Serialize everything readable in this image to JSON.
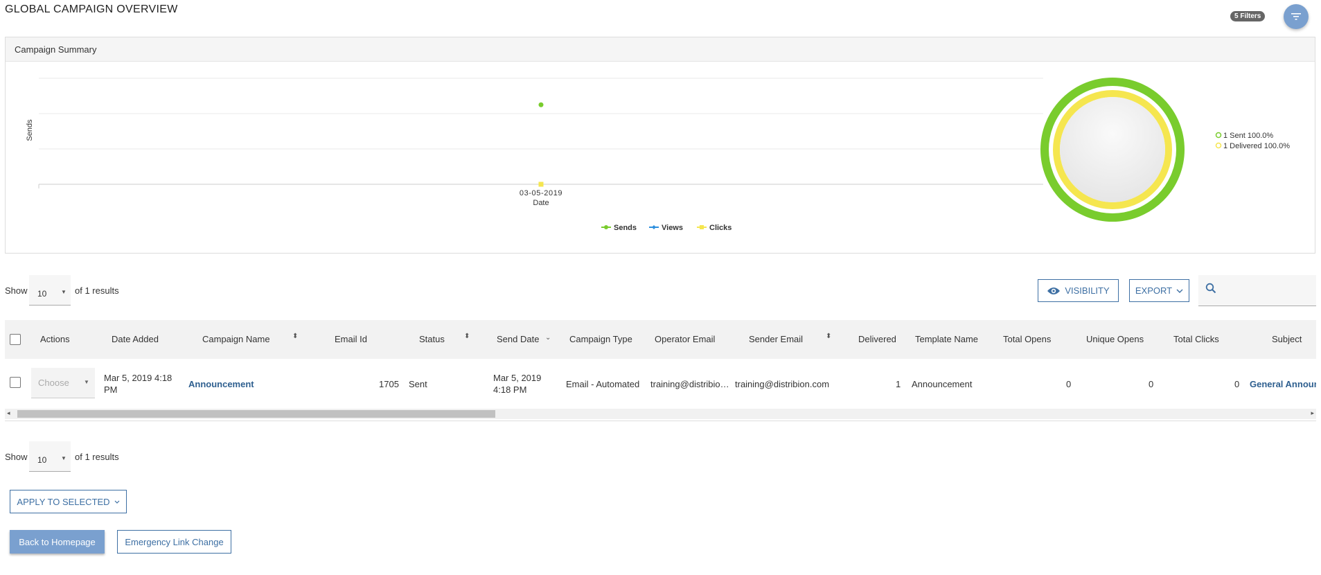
{
  "page": {
    "title": "GLOBAL CAMPAIGN OVERVIEW",
    "filters_badge": "5 Filters",
    "filter_icon": "filter-icon"
  },
  "summary": {
    "title": "Campaign Summary",
    "donut_legend": [
      "1 Sent 100.0%",
      "1 Delivered 100.0%"
    ]
  },
  "chart_data": [
    {
      "type": "line",
      "ylabel": "Sends",
      "xlabel": "Date",
      "x": [
        "03-05-2019"
      ],
      "series": [
        {
          "name": "Sends",
          "values": [
            1
          ],
          "color": "#79cc2d"
        },
        {
          "name": "Views",
          "values": [
            null
          ],
          "color": "#2d8fde"
        },
        {
          "name": "Clicks",
          "values": [
            0
          ],
          "color": "#f5e64f"
        }
      ],
      "grid": true,
      "legend": "bottom"
    },
    {
      "type": "pie",
      "series": [
        {
          "name": "Sent",
          "values": [
            1
          ],
          "percent": 100.0,
          "color": "#79cc2d"
        },
        {
          "name": "Delivered",
          "values": [
            1
          ],
          "percent": 100.0,
          "color": "#f5e64f"
        }
      ],
      "legend": "right"
    }
  ],
  "pager": {
    "show_label": "Show",
    "page_size": "10",
    "results_text": "of 1 results"
  },
  "toolbar": {
    "visibility_label": "VISIBILITY",
    "export_label": "EXPORT",
    "search_placeholder": ""
  },
  "table": {
    "headers": {
      "actions": "Actions",
      "date_added": "Date Added",
      "campaign_name": "Campaign Name",
      "email_id": "Email Id",
      "status": "Status",
      "send_date": "Send Date",
      "campaign_type": "Campaign Type",
      "operator_email": "Operator Email",
      "sender_email": "Sender Email",
      "delivered": "Delivered",
      "template_name": "Template Name",
      "total_opens": "Total Opens",
      "unique_opens": "Unique Opens",
      "total_clicks": "Total Clicks",
      "subject": "Subject"
    },
    "rows": [
      {
        "action_placeholder": "Choose",
        "date_added_1": "Mar 5, 2019 4:18",
        "date_added_2": "PM",
        "campaign_name": "Announcement",
        "email_id": "1705",
        "status": "Sent",
        "send_date_1": "Mar 5, 2019",
        "send_date_2": "4:18 PM",
        "campaign_type": "Email - Automated",
        "operator_email": "training@distribio…",
        "sender_email": "training@distribion.com",
        "delivered": "1",
        "template_name": "Announcement",
        "total_opens": "0",
        "unique_opens": "0",
        "total_clicks": "0",
        "subject": "General Announc"
      }
    ]
  },
  "footer": {
    "apply_label": "APPLY TO SELECTED",
    "back_label": "Back to Homepage",
    "emergency_label": "Emergency Link Change"
  }
}
